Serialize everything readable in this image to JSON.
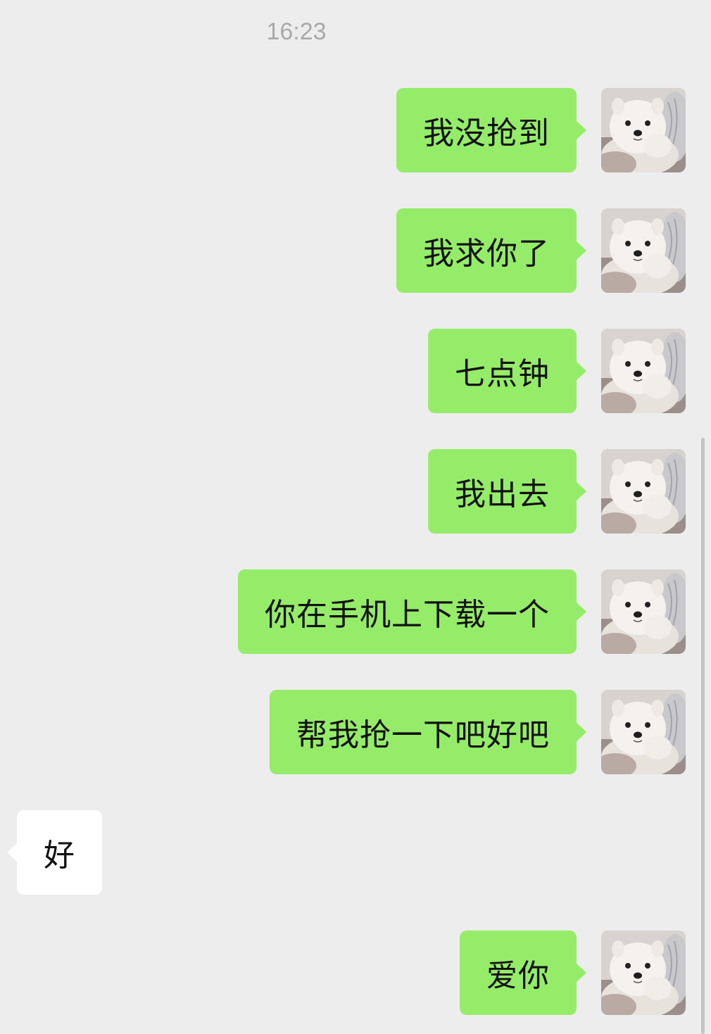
{
  "chat": {
    "timestamp": "16:23",
    "messages": [
      {
        "side": "out",
        "text": "我没抢到"
      },
      {
        "side": "out",
        "text": "我求你了"
      },
      {
        "side": "out",
        "text": "七点钟"
      },
      {
        "side": "out",
        "text": "我出去"
      },
      {
        "side": "out",
        "text": "你在手机上下载一个"
      },
      {
        "side": "out",
        "text": "帮我抢一下吧好吧"
      },
      {
        "side": "in",
        "text": "好"
      },
      {
        "side": "out",
        "text": "爱你"
      }
    ]
  },
  "avatar_icon": "samoyed-puppy-avatar",
  "colors": {
    "background": "#ededed",
    "outgoing_bubble": "#95ec69",
    "incoming_bubble": "#ffffff",
    "timestamp_text": "#a9a9a9"
  }
}
